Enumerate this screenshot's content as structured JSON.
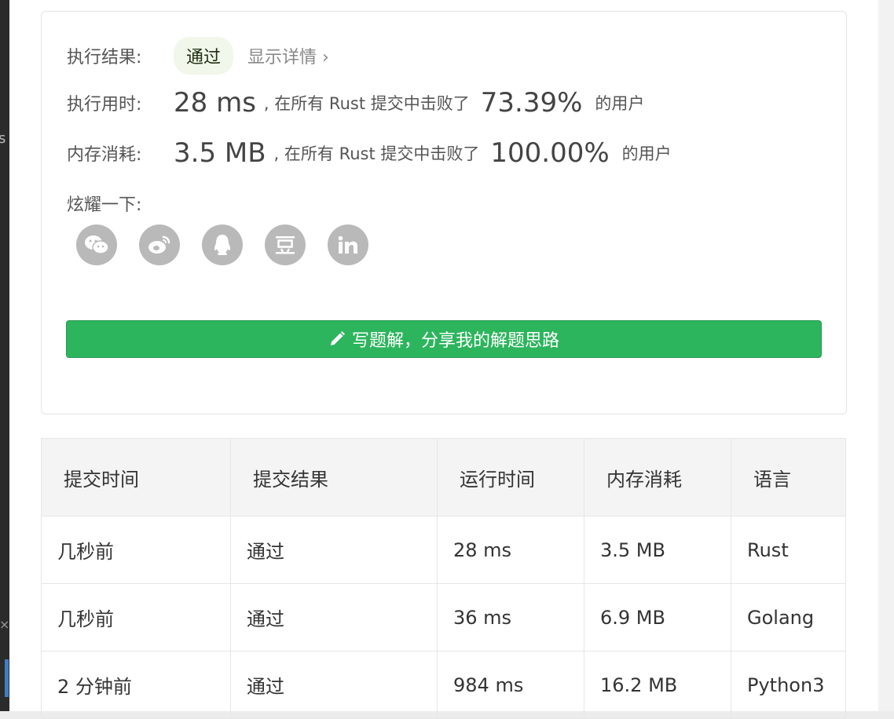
{
  "result": {
    "label": "执行结果:",
    "status": "通过",
    "detail_link": "显示详情 ›"
  },
  "runtime": {
    "label": "执行用时:",
    "value": "28 ms",
    "middle": ", 在所有 Rust 提交中击败了",
    "percent": "73.39%",
    "suffix": "的用户"
  },
  "memory": {
    "label": "内存消耗:",
    "value": "3.5 MB",
    "middle": ", 在所有 Rust 提交中击败了",
    "percent": "100.00%",
    "suffix": "的用户"
  },
  "share": {
    "label": "炫耀一下:",
    "icons": [
      "wechat-icon",
      "weibo-icon",
      "qq-icon",
      "douban-icon",
      "linkedin-icon"
    ]
  },
  "write_button": {
    "label": "写题解，分享我的解题思路"
  },
  "table": {
    "headers": [
      "提交时间",
      "提交结果",
      "运行时间",
      "内存消耗",
      "语言"
    ],
    "rows": [
      {
        "time": "几秒前",
        "result": "通过",
        "runtime": "28 ms",
        "memory": "3.5 MB",
        "language": "Rust"
      },
      {
        "time": "几秒前",
        "result": "通过",
        "runtime": "36 ms",
        "memory": "6.9 MB",
        "language": "Golang"
      },
      {
        "time": "2 分钟前",
        "result": "通过",
        "runtime": "984 ms",
        "memory": "16.2 MB",
        "language": "Python3"
      }
    ]
  },
  "colors": {
    "accent_green": "#2db55d",
    "pass_text": "#5cb531",
    "badge_bg": "#f1f7ea",
    "icon_gray": "#b9b9b9"
  }
}
